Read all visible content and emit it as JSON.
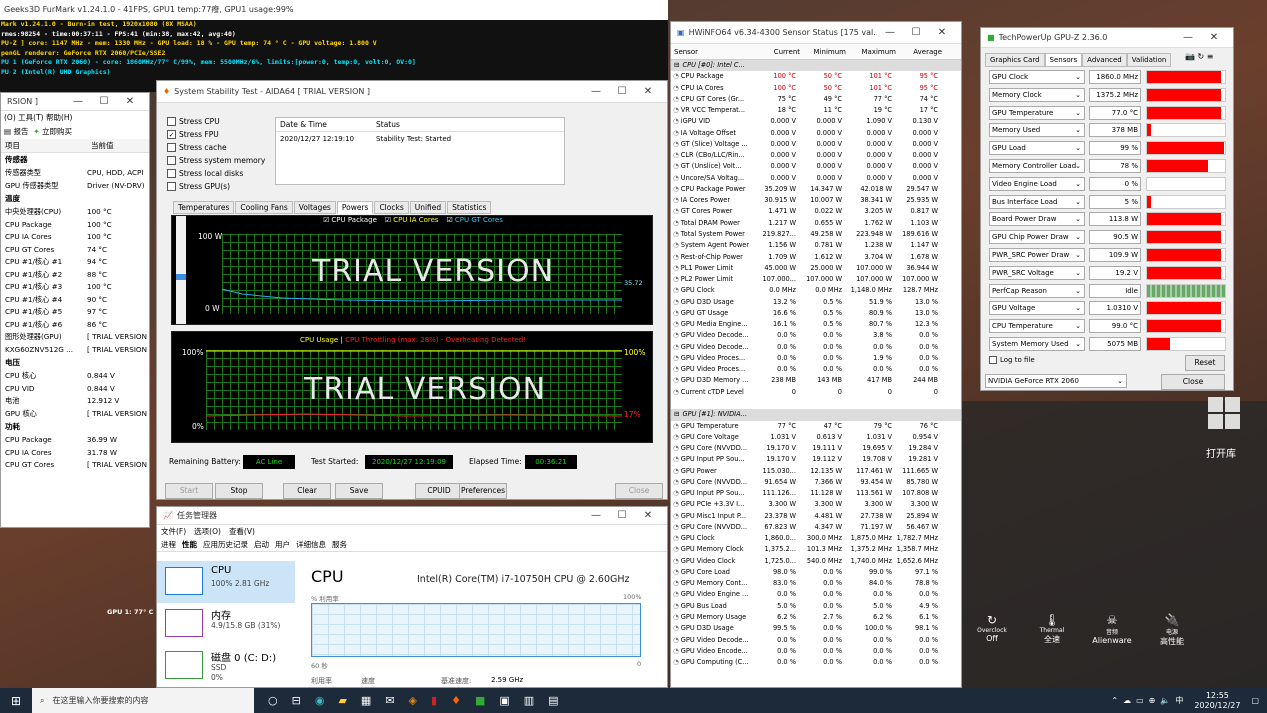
{
  "furmark": {
    "title": "Geeks3D FurMark v1.24.1.0 - 41FPS, GPU1 temp:77癈, GPU1 usage:99%",
    "lines": [
      "Mark v1.24.1.0 - Burn-in test, 1920x1080 (8X MSAA)",
      "rmes:98254 - time:00:37:11 - FPS:41 (min:38, max:42, avg:40)",
      "PU-Z ] core: 1147 MHz - mem: 1330 MHz - GPU load: 18 % - GPU temp: 74 ° C - GPU voltage: 1.800 V",
      "penGL renderer: GeForce RTX 2060/PCIe/SSE2",
      "PU 1 (GeForce RTX 2060) - core: 1860MHz/77° C/99%, mem: 5500MHz/6%, limits:[power:0, temp:0, volt:0, OV:0]",
      "PU 2 (Intel(R) UHD Graphics)"
    ],
    "line_colors": [
      "#ffd700",
      "#ffffff",
      "#ffd700",
      "#ffd700",
      "#00e5ff",
      "#00e5ff"
    ],
    "gpu_overlay": "GPU 1: 77° C"
  },
  "aida_sensor": {
    "title": "RSION ]",
    "menu": "(O)  工具(T)  帮助(H)",
    "tool_report": "报告",
    "tool_buy": "立即购买",
    "col_item": "项目",
    "col_value": "当前值",
    "sections": [
      {
        "name": "传感器",
        "rows": [
          [
            "传感器类型",
            "CPU, HDD, ACPI"
          ],
          [
            "GPU 传感器类型",
            "Driver (NV-DRV)"
          ]
        ]
      },
      {
        "name": "温度",
        "rows": [
          [
            "中央处理器(CPU)",
            "100 °C"
          ],
          [
            "CPU Package",
            "100 °C"
          ],
          [
            "CPU IA Cores",
            "100 °C"
          ],
          [
            "CPU GT Cores",
            "74 °C"
          ],
          [
            "CPU #1/核心 #1",
            "94 °C"
          ],
          [
            "CPU #1/核心 #2",
            "88 °C"
          ],
          [
            "CPU #1/核心 #3",
            "100 °C"
          ],
          [
            "CPU #1/核心 #4",
            "90 °C"
          ],
          [
            "CPU #1/核心 #5",
            "97 °C"
          ],
          [
            "CPU #1/核心 #6",
            "86 °C"
          ],
          [
            "图形处理器(GPU)",
            "[ TRIAL VERSION ]"
          ],
          [
            "KXG60ZNV512G ...",
            "[ TRIAL VERSION ]"
          ]
        ]
      },
      {
        "name": "电压",
        "rows": [
          [
            "CPU 核心",
            "0.844 V"
          ],
          [
            "CPU VID",
            "0.844 V"
          ],
          [
            "电池",
            "12.912 V"
          ],
          [
            "GPU 核心",
            "[ TRIAL VERSION ]"
          ]
        ]
      },
      {
        "name": "功耗",
        "rows": [
          [
            "CPU Package",
            "36.99 W"
          ],
          [
            "CPU IA Cores",
            "31.78 W"
          ],
          [
            "CPU GT Cores",
            "[ TRIAL VERSION ]"
          ]
        ]
      }
    ]
  },
  "stability": {
    "title": "System Stability Test - AIDA64  [ TRIAL VERSION ]",
    "stress": [
      [
        "Stress CPU",
        false
      ],
      [
        "Stress FPU",
        true
      ],
      [
        "Stress cache",
        false
      ],
      [
        "Stress system memory",
        false
      ],
      [
        "Stress local disks",
        false
      ],
      [
        "Stress GPU(s)",
        false
      ]
    ],
    "log_col_date": "Date & Time",
    "log_col_status": "Status",
    "log_date": "2020/12/27 12:19:10",
    "log_status": "Stability Test: Started",
    "tabs": [
      "Temperatures",
      "Cooling Fans",
      "Voltages",
      "Powers",
      "Clocks",
      "Unified",
      "Statistics"
    ],
    "active_tab": "Powers",
    "legend": [
      "CPU Package",
      "CPU IA Cores",
      "CPU GT Cores"
    ],
    "g1_top": "100 W",
    "g1_bot": "0 W",
    "g1_val": "35.72",
    "trial": "TRIAL VERSION",
    "g2_title_a": "CPU Usage",
    "g2_sep": "|",
    "g2_title_b": "CPU Throttling (max: 28%) - Overheating Detected!",
    "g2_top_l": "100%",
    "g2_top_r": "100%",
    "g2_bot_l": "0%",
    "g2_bot_r": "17%",
    "battery_label": "Remaining Battery:",
    "battery": "AC Line",
    "started_label": "Test Started:",
    "started": "2020/12/27 12:19:09",
    "elapsed_label": "Elapsed Time:",
    "elapsed": "00:36:21",
    "buttons": [
      "Start",
      "Stop",
      "Clear",
      "Save",
      "CPUID",
      "Preferences",
      "Close"
    ]
  },
  "taskmgr": {
    "title": "任务管理器",
    "menu": [
      "文件(F)",
      "选项(O)",
      "查看(V)"
    ],
    "tabs": [
      "进程",
      "性能",
      "应用历史记录",
      "启动",
      "用户",
      "详细信息",
      "服务"
    ],
    "items": [
      {
        "name": "CPU",
        "sub": "100%  2.81 GHz"
      },
      {
        "name": "内存",
        "sub": "4.9/15.8 GB (31%)"
      },
      {
        "name": "磁盘 0 (C: D:)",
        "sub": "SSD",
        "sub2": "0%"
      }
    ],
    "heading": "CPU",
    "cpu_name": "Intel(R) Core(TM) i7-10750H CPU @ 2.60GHz",
    "util_label": "% 利用率",
    "util_max": "100%",
    "time_label": "60 秒",
    "time_end": "0",
    "f1": "利用率",
    "f2": "速度",
    "f3": "基准速度:",
    "f3v": "2.59 GHz"
  },
  "hwinfo": {
    "title": "HWiNFO64 v6.34-4300 Sensor Status [175 val...",
    "cols": [
      "Sensor",
      "Current",
      "Minimum",
      "Maximum",
      "Average"
    ],
    "rows": [
      [
        "s",
        "CPU [#0]: Intel C..."
      ],
      [
        "CPU Package",
        "100 °C",
        "50 °C",
        "101 °C",
        "95 °C",
        1
      ],
      [
        "CPU IA Cores",
        "100 °C",
        "50 °C",
        "101 °C",
        "95 °C",
        1
      ],
      [
        "CPU GT Cores (Gr...",
        "75 °C",
        "49 °C",
        "77 °C",
        "74 °C",
        0
      ],
      [
        "VR VCC Temperat...",
        "18 °C",
        "11 °C",
        "19 °C",
        "17 °C",
        0
      ],
      [
        "iGPU VID",
        "0.000 V",
        "0.000 V",
        "1.090 V",
        "0.130 V",
        0
      ],
      [
        "IA Voltage Offset",
        "0.000 V",
        "0.000 V",
        "0.000 V",
        "0.000 V",
        0
      ],
      [
        "GT (Slice) Voltage ...",
        "0.000 V",
        "0.000 V",
        "0.000 V",
        "0.000 V",
        0
      ],
      [
        "CLR (CBo/LLC/Rin...",
        "0.000 V",
        "0.000 V",
        "0.000 V",
        "0.000 V",
        0
      ],
      [
        "GT (Unslice) Volt...",
        "0.000 V",
        "0.000 V",
        "0.000 V",
        "0.000 V",
        0
      ],
      [
        "Uncore/SA Voltag...",
        "0.000 V",
        "0.000 V",
        "0.000 V",
        "0.000 V",
        0
      ],
      [
        "CPU Package Power",
        "35.209 W",
        "14.347 W",
        "42.018 W",
        "29.547 W",
        0
      ],
      [
        "IA Cores Power",
        "30.915 W",
        "10.007 W",
        "38.341 W",
        "25.935 W",
        0
      ],
      [
        "GT Cores Power",
        "1.471 W",
        "0.022 W",
        "3.205 W",
        "0.817 W",
        0
      ],
      [
        "Total DRAM Power",
        "1.217 W",
        "0.655 W",
        "1.762 W",
        "1.103 W",
        0
      ],
      [
        "Total System Power",
        "219.827...",
        "49.258 W",
        "223.948 W",
        "189.616 W",
        0
      ],
      [
        "System Agent Power",
        "1.156 W",
        "0.781 W",
        "1.238 W",
        "1.147 W",
        0
      ],
      [
        "Rest-of-Chip Power",
        "1.709 W",
        "1.612 W",
        "3.704 W",
        "1.678 W",
        0
      ],
      [
        "PL1 Power Limit",
        "45.000 W",
        "25.000 W",
        "107.000 W",
        "36.944 W",
        0
      ],
      [
        "PL2 Power Limit",
        "107.000...",
        "107.000 W",
        "107.000 W",
        "107.000 W",
        0
      ],
      [
        "GPU Clock",
        "0.0 MHz",
        "0.0 MHz",
        "1,148.0 MHz",
        "128.7 MHz",
        0
      ],
      [
        "GPU D3D Usage",
        "13.2 %",
        "0.5 %",
        "51.9 %",
        "13.0 %",
        0
      ],
      [
        "GPU GT Usage",
        "16.6 %",
        "0.5 %",
        "80.9 %",
        "13.0 %",
        0
      ],
      [
        "GPU Media Engine...",
        "16.1 %",
        "0.5 %",
        "80.7 %",
        "12.3 %",
        0
      ],
      [
        "GPU Video Decode...",
        "0.0 %",
        "0.0 %",
        "3.8 %",
        "0.0 %",
        0
      ],
      [
        "GPU Video Decode...",
        "0.0 %",
        "0.0 %",
        "0.0 %",
        "0.0 %",
        0
      ],
      [
        "GPU Video Proces...",
        "0.0 %",
        "0.0 %",
        "1.9 %",
        "0.0 %",
        0
      ],
      [
        "GPU Video Proces...",
        "0.0 %",
        "0.0 %",
        "0.0 %",
        "0.0 %",
        0
      ],
      [
        "GPU D3D Memory ...",
        "238 MB",
        "143 MB",
        "417 MB",
        "244 MB",
        0
      ],
      [
        "Current cTDP Level",
        "0",
        "0",
        "0",
        "0",
        0
      ],
      [
        "e",
        ""
      ],
      [
        "s",
        "GPU [#1]: NVIDIA..."
      ],
      [
        "GPU Temperature",
        "77 °C",
        "47 °C",
        "79 °C",
        "76 °C",
        0
      ],
      [
        "GPU Core Voltage",
        "1.031 V",
        "0.613 V",
        "1.031 V",
        "0.954 V",
        0
      ],
      [
        "GPU Core (NVVDD...",
        "19.170 V",
        "19.111 V",
        "19.695 V",
        "19.284 V",
        0
      ],
      [
        "GPU Input PP Sou...",
        "19.170 V",
        "19.112 V",
        "19.708 V",
        "19.281 V",
        0
      ],
      [
        "GPU Power",
        "115.030...",
        "12.135 W",
        "117.461 W",
        "111.665 W",
        0
      ],
      [
        "GPU Core (NVVDD...",
        "91.654 W",
        "7.366 W",
        "93.454 W",
        "85.780 W",
        0
      ],
      [
        "GPU Input PP Sou...",
        "111.126...",
        "11.128 W",
        "113.561 W",
        "107.808 W",
        0
      ],
      [
        "GPU PCIe +3.3V I...",
        "3.300 W",
        "3.300 W",
        "3.300 W",
        "3.300 W",
        0
      ],
      [
        "GPU Misc1 Input P...",
        "23.378 W",
        "4.481 W",
        "27.738 W",
        "25.894 W",
        0
      ],
      [
        "GPU Core (NVVDD...",
        "67.823 W",
        "4.347 W",
        "71.197 W",
        "56.467 W",
        0
      ],
      [
        "GPU Clock",
        "1,860.0...",
        "300.0 MHz",
        "1,875.0 MHz",
        "1,782.7 MHz",
        0
      ],
      [
        "GPU Memory Clock",
        "1,375.2...",
        "101.3 MHz",
        "1,375.2 MHz",
        "1,358.7 MHz",
        0
      ],
      [
        "GPU Video Clock",
        "1,725.0...",
        "540.0 MHz",
        "1,740.0 MHz",
        "1,652.6 MHz",
        0
      ],
      [
        "GPU Core Load",
        "98.0 %",
        "0.0 %",
        "99.0 %",
        "97.1 %",
        0
      ],
      [
        "GPU Memory Cont...",
        "83.0 %",
        "0.0 %",
        "84.0 %",
        "78.8 %",
        0
      ],
      [
        "GPU Video Engine ...",
        "0.0 %",
        "0.0 %",
        "0.0 %",
        "0.0 %",
        0
      ],
      [
        "GPU Bus Load",
        "5.0 %",
        "0.0 %",
        "5.0 %",
        "4.9 %",
        0
      ],
      [
        "GPU Memory Usage",
        "6.2 %",
        "2.7 %",
        "6.2 %",
        "6.1 %",
        0
      ],
      [
        "GPU D3D Usage",
        "99.5 %",
        "0.0 %",
        "100.0 %",
        "98.1 %",
        0
      ],
      [
        "GPU Video Decode...",
        "0.0 %",
        "0.0 %",
        "0.0 %",
        "0.0 %",
        0
      ],
      [
        "GPU Video Encode...",
        "0.0 %",
        "0.0 %",
        "0.0 %",
        "0.0 %",
        0
      ],
      [
        "GPU Computing (C...",
        "0.0 %",
        "0.0 %",
        "0.0 %",
        "0.0 %",
        0
      ]
    ]
  },
  "gpuz": {
    "title": "TechPowerUp GPU-Z 2.36.0",
    "tabs": [
      "Graphics Card",
      "Sensors",
      "Advanced",
      "Validation"
    ],
    "rows": [
      [
        "GPU Clock",
        "1860.0 MHz",
        0.95
      ],
      [
        "Memory Clock",
        "1375.2 MHz",
        0.95
      ],
      [
        "GPU Temperature",
        "77.0 °C",
        0.95
      ],
      [
        "Memory Used",
        "378 MB",
        0.05
      ],
      [
        "GPU Load",
        "99 %",
        0.99
      ],
      [
        "Memory Controller Load",
        "78 %",
        0.78
      ],
      [
        "Video Engine Load",
        "0 %",
        0
      ],
      [
        "Bus Interface Load",
        "5 %",
        0.05
      ],
      [
        "Board Power Draw",
        "113.8 W",
        0.95
      ],
      [
        "GPU Chip Power Draw",
        "90.5 W",
        0.95
      ],
      [
        "PWR_SRC Power Draw",
        "109.9 W",
        0.95
      ],
      [
        "PWR_SRC Voltage",
        "19.2 V",
        0.95
      ],
      [
        "PerfCap Reason",
        "Idle",
        1
      ],
      [
        "GPU Voltage",
        "1.0310 V",
        0.95
      ],
      [
        "CPU Temperature",
        "99.0 °C",
        0.95
      ],
      [
        "System Memory Used",
        "5075 MB",
        0.3
      ]
    ],
    "log": "Log to file",
    "reset": "Reset",
    "device": "NVIDIA GeForce RTX 2060",
    "close": "Close"
  },
  "side": {
    "apps": "打开库",
    "items": [
      [
        "Overclock",
        "Off"
      ],
      [
        "Thermal",
        "全速"
      ],
      [
        "音频",
        "Alienware"
      ],
      [
        "电源",
        "高性能"
      ]
    ]
  },
  "taskbar": {
    "search": "在这里输入你要搜索的内容",
    "time": "12:55",
    "date": "2020/12/27",
    "ime": "中"
  }
}
